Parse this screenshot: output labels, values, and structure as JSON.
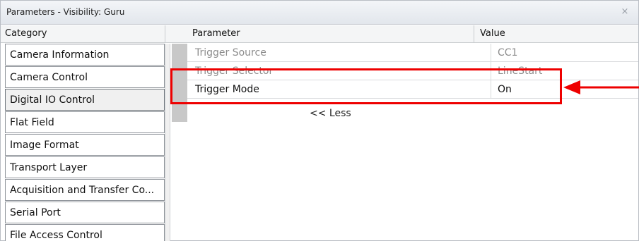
{
  "window": {
    "title": "Parameters - Visibility: Guru",
    "close_glyph": "×"
  },
  "header": {
    "category": "Category",
    "parameter": "Parameter",
    "value": "Value"
  },
  "categories": [
    {
      "label": "Camera Information"
    },
    {
      "label": "Camera Control"
    },
    {
      "label": "Digital IO Control",
      "selected": true
    },
    {
      "label": "Flat Field"
    },
    {
      "label": "Image Format"
    },
    {
      "label": "Transport Layer"
    },
    {
      "label": "Acquisition and Transfer Co..."
    },
    {
      "label": "Serial Port"
    },
    {
      "label": "File Access Control"
    }
  ],
  "parameters": [
    {
      "name": "Trigger Source",
      "value": "CC1",
      "enabled": false
    },
    {
      "name": "Trigger Selector",
      "value": "LineStart",
      "enabled": false
    },
    {
      "name": "Trigger Mode",
      "value": "On",
      "enabled": true
    }
  ],
  "less_link": "<< Less",
  "colors": {
    "highlight": "#ee0000",
    "disabled_text": "#8c8c8c"
  }
}
